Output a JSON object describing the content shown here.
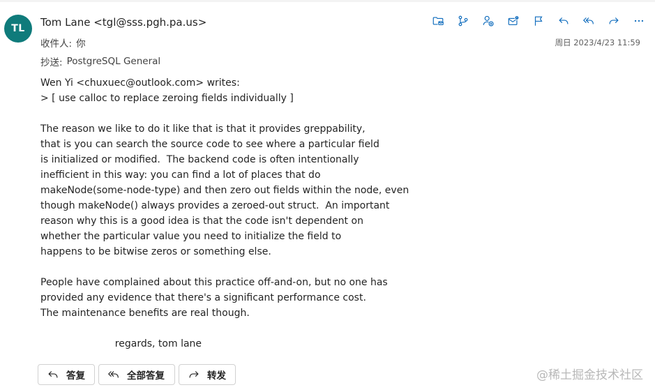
{
  "email": {
    "avatar_initials": "TL",
    "sender": "Tom Lane <tgl@sss.pgh.pa.us>",
    "to_label": "收件人:",
    "to_value": "你",
    "cc_label": "抄送:",
    "cc_value": "PostgreSQL General",
    "date": "周日 2023/4/23 11:59",
    "body_lines": [
      "Wen Yi <chuxuec@outlook.com> writes:",
      "> [ use calloc to replace zeroing fields individually ]",
      "",
      "The reason we like to do it like that is that it provides greppability,",
      "that is you can search the source code to see where a particular field",
      "is initialized or modified.  The backend code is often intentionally",
      "inefficient in this way: you can find a lot of places that do",
      "makeNode(some-node-type) and then zero out fields within the node, even",
      "though makeNode() always provides a zeroed-out struct.  An important",
      "reason why this is a good idea is that the code isn't dependent on",
      "whether the particular value you need to initialize the field to",
      "happens to be bitwise zeros or something else.",
      "",
      "People have complained about this practice off-and-on, but no one has",
      "provided any evidence that there's a significant performance cost.",
      "The maintenance benefits are real though.",
      "",
      "                        regards, tom lane"
    ]
  },
  "toolbar": {
    "icons": [
      "move-to-folder-icon",
      "branch-icon",
      "add-contact-icon",
      "mail-badge-icon",
      "flag-icon",
      "reply-icon",
      "reply-all-icon",
      "forward-icon",
      "more-icon"
    ]
  },
  "actions": {
    "reply_label": "答复",
    "reply_all_label": "全部答复",
    "forward_label": "转发"
  },
  "watermark": "@稀土掘金技术社区",
  "colors": {
    "avatar_bg": "#0f7b7b",
    "accent": "#0f6cbd"
  }
}
